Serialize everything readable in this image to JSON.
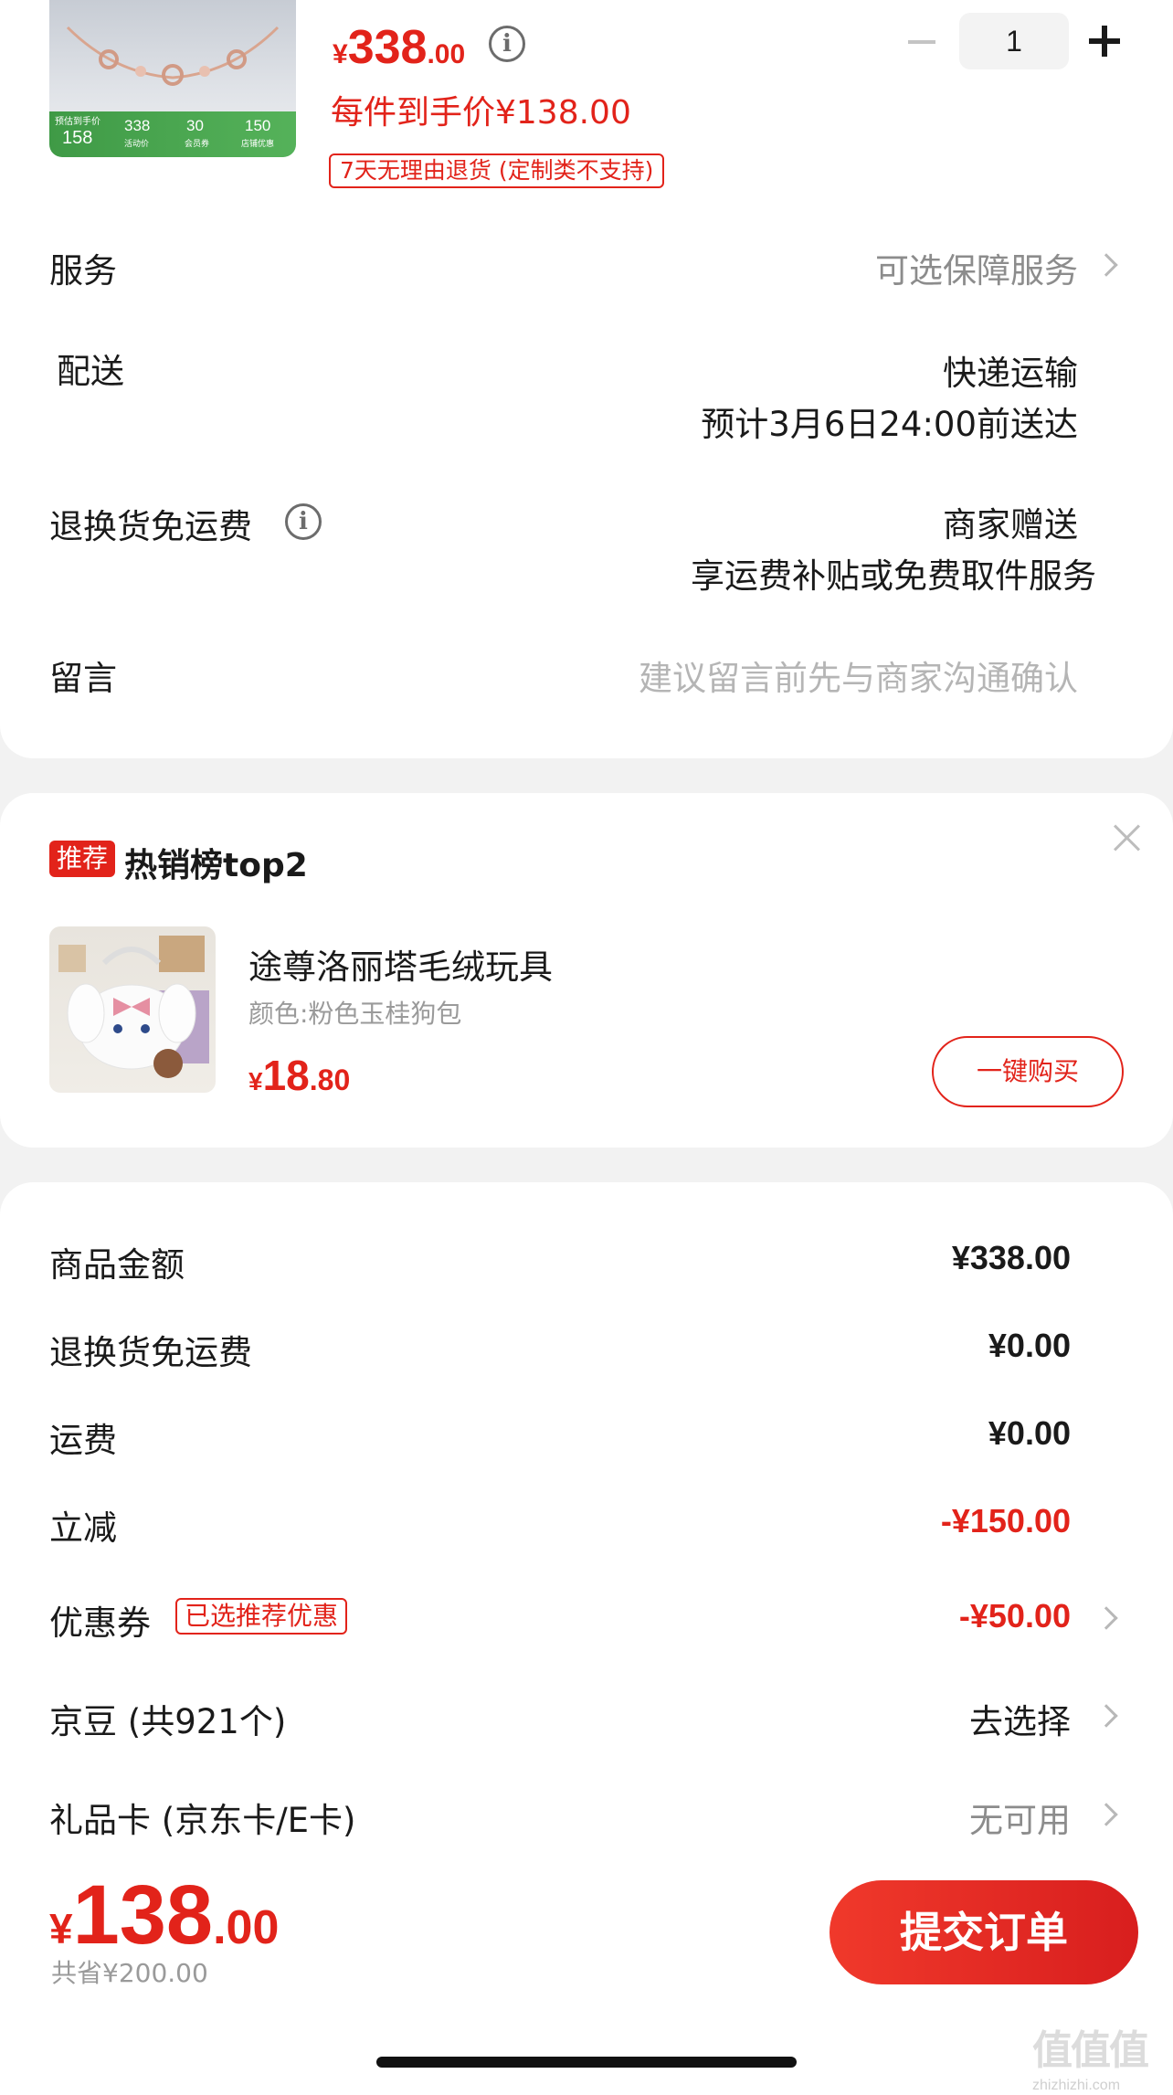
{
  "product": {
    "image_strip": {
      "label": "预估到手价",
      "final": "158",
      "price_a": "338",
      "price_a_note": "活动价",
      "price_b": "30",
      "price_b_note": "会员券",
      "price_c": "150",
      "price_c_note": "店铺优惠"
    },
    "price_currency": "¥",
    "price_int": "338",
    "price_dec": ".00",
    "each_price": "每件到手价¥138.00",
    "return_tag": "7天无理由退货 (定制类不支持)",
    "quantity": "1"
  },
  "rows": {
    "service_label": "服务",
    "service_value": "可选保障服务",
    "delivery_label": "配送",
    "delivery_method": "快递运输",
    "delivery_eta": "预计3月6日24:00前送达",
    "return_free_label": "退换货免运费",
    "return_free_value1": "商家赠送",
    "return_free_value2": "享运费补贴或免费取件服务",
    "message_label": "留言",
    "message_placeholder": "建议留言前先与商家沟通确认"
  },
  "recommend": {
    "badge": "推荐",
    "title": "热销榜top2",
    "item_name": "途尊洛丽塔毛绒玩具",
    "item_spec": "颜色:粉色玉桂狗包",
    "price_currency": "¥",
    "price_int": "18",
    "price_dec": ".80",
    "buy_label": "一键购买"
  },
  "summary": {
    "goods_label": "商品金额",
    "goods_value": "¥338.00",
    "return_label": "退换货免运费",
    "return_value": "¥0.00",
    "shipping_label": "运费",
    "shipping_value": "¥0.00",
    "discount_label": "立减",
    "discount_value": "-¥150.00",
    "coupon_label": "优惠券",
    "coupon_tag": "已选推荐优惠",
    "coupon_value": "-¥50.00",
    "jingdou_label": "京豆 (共921个)",
    "jingdou_value": "去选择",
    "giftcard_label": "礼品卡 (京东卡/E卡)",
    "giftcard_value": "无可用"
  },
  "footer": {
    "total_currency": "¥",
    "total_int": "138",
    "total_dec": ".00",
    "saved": "共省¥200.00",
    "submit_label": "提交订单"
  },
  "watermark": {
    "glyphs": "值值值",
    "url": "zhizhizhi.com"
  },
  "colors": {
    "accent": "#e2231a",
    "background": "#f2f2f2",
    "card": "#ffffff"
  }
}
